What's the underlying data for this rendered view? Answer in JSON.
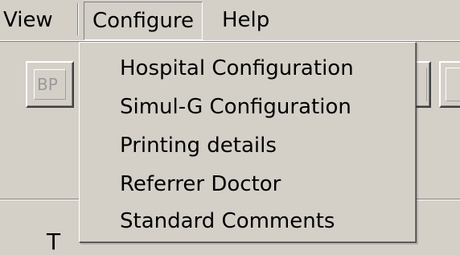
{
  "menubar": {
    "items": [
      {
        "label": "View"
      },
      {
        "label": "Configure",
        "state": "open"
      },
      {
        "label": "Help"
      }
    ]
  },
  "toolbar": {
    "bp_label": "BP"
  },
  "configure_menu": {
    "items": [
      {
        "label": "Hospital Configuration"
      },
      {
        "label": "Simul-G Configuration"
      },
      {
        "label": "Printing details"
      },
      {
        "label": "Referrer Doctor"
      },
      {
        "label": "Standard Comments"
      }
    ]
  },
  "panel": {
    "partial_text": "T"
  },
  "colors": {
    "background": "#d4d0c8",
    "shadow": "#808080",
    "highlight": "#ffffff"
  }
}
